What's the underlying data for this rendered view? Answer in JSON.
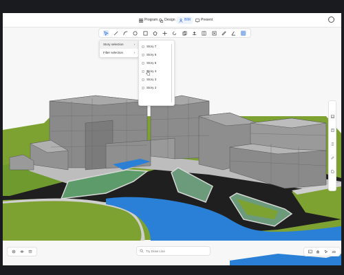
{
  "topbar": {
    "tabs": [
      {
        "label": "Program",
        "icon": "grid-icon"
      },
      {
        "label": "Design",
        "icon": "shapes-icon"
      },
      {
        "label": "BIM",
        "icon": "person-icon"
      },
      {
        "label": "Present",
        "icon": "present-icon"
      }
    ],
    "active_tab": "BIM"
  },
  "selection_menu": {
    "items": [
      {
        "label": "Story selection",
        "arrow": "›"
      },
      {
        "label": "Filter selection",
        "arrow": "›"
      }
    ]
  },
  "story_menu": {
    "items": [
      "Story 7",
      "Story 6",
      "Story 5",
      "Story 4",
      "Story 3",
      "Story 2"
    ]
  },
  "search": {
    "placeholder": "Try Draw Line"
  },
  "bottom_right": {
    "view_label": "2D"
  },
  "colors": {
    "accent": "#2f6fe0",
    "grass": "#7ea232",
    "water": "#2a7fd6",
    "road": "#202020",
    "building": "#8c8c8c"
  }
}
